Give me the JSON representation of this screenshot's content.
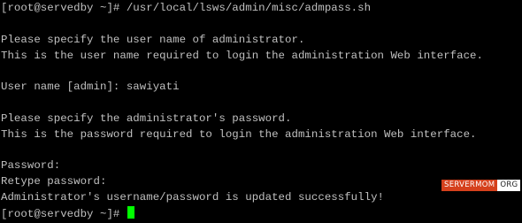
{
  "terminal": {
    "lines": [
      "[root@servedby ~]# /usr/local/lsws/admin/misc/admpass.sh",
      "",
      "Please specify the user name of administrator.",
      "This is the user name required to login the administration Web interface.",
      "",
      "User name [admin]: sawiyati",
      "",
      "Please specify the administrator's password.",
      "This is the password required to login the administration Web interface.",
      "",
      "Password:",
      "Retype password:",
      "Administrator's username/password is updated successfully!",
      "[root@servedby ~]# "
    ],
    "cursor_color": "#00ff00",
    "text_color": "#c0c0c0",
    "background_color": "#000000"
  },
  "watermark": {
    "part1": "SERVERMOM",
    "part2": "ORG",
    "part1_color": "#d5401c"
  }
}
